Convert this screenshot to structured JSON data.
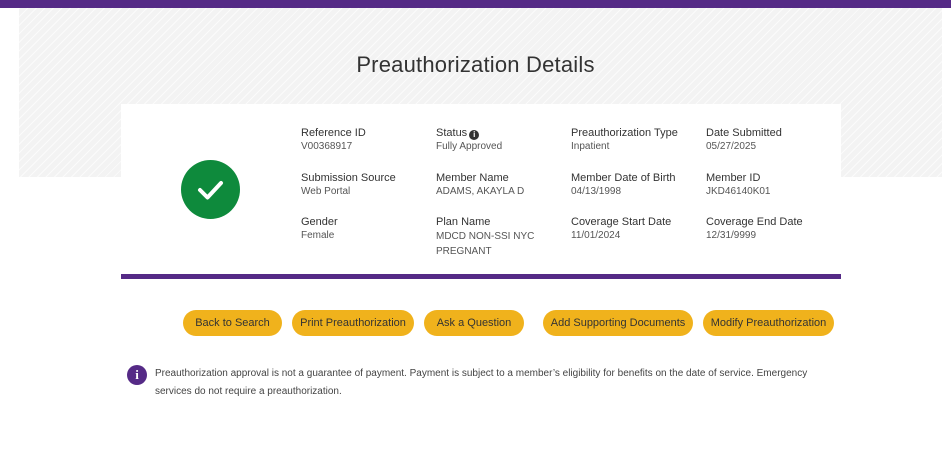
{
  "page": {
    "title": "Preauthorization Details"
  },
  "colors": {
    "brand_purple": "#552a86",
    "success_green": "#0e8a3c",
    "button_yellow": "#f0b21c"
  },
  "status_icon": "check-circle-icon",
  "details": {
    "reference_id": {
      "label": "Reference ID",
      "value": "V00368917"
    },
    "status": {
      "label": "Status",
      "value": "Fully Approved",
      "info_icon": "info-icon"
    },
    "preauth_type": {
      "label": "Preauthorization Type",
      "value": "Inpatient"
    },
    "date_submitted": {
      "label": "Date Submitted",
      "value": "05/27/2025"
    },
    "submission_source": {
      "label": "Submission Source",
      "value": "Web Portal"
    },
    "member_name": {
      "label": "Member Name",
      "value": "ADAMS, AKAYLA D"
    },
    "member_dob": {
      "label": "Member Date of Birth",
      "value": "04/13/1998"
    },
    "member_id": {
      "label": "Member ID",
      "value": "JKD46140K01"
    },
    "gender": {
      "label": "Gender",
      "value": "Female"
    },
    "plan_name": {
      "label": "Plan Name",
      "value": "MDCD NON-SSI NYC PREGNANT"
    },
    "coverage_start": {
      "label": "Coverage Start Date",
      "value": "11/01/2024"
    },
    "coverage_end": {
      "label": "Coverage End Date",
      "value": "12/31/9999"
    }
  },
  "actions": {
    "back": "Back to Search",
    "print": "Print Preauthorization",
    "ask": "Ask a Question",
    "add_docs": "Add Supporting Documents",
    "modify": "Modify Preauthorization"
  },
  "notice": {
    "icon": "info-icon",
    "text": "Preauthorization approval is not a guarantee of payment. Payment is subject to a member’s eligibility for benefits on the date of service. Emergency services do not require a preauthorization."
  }
}
